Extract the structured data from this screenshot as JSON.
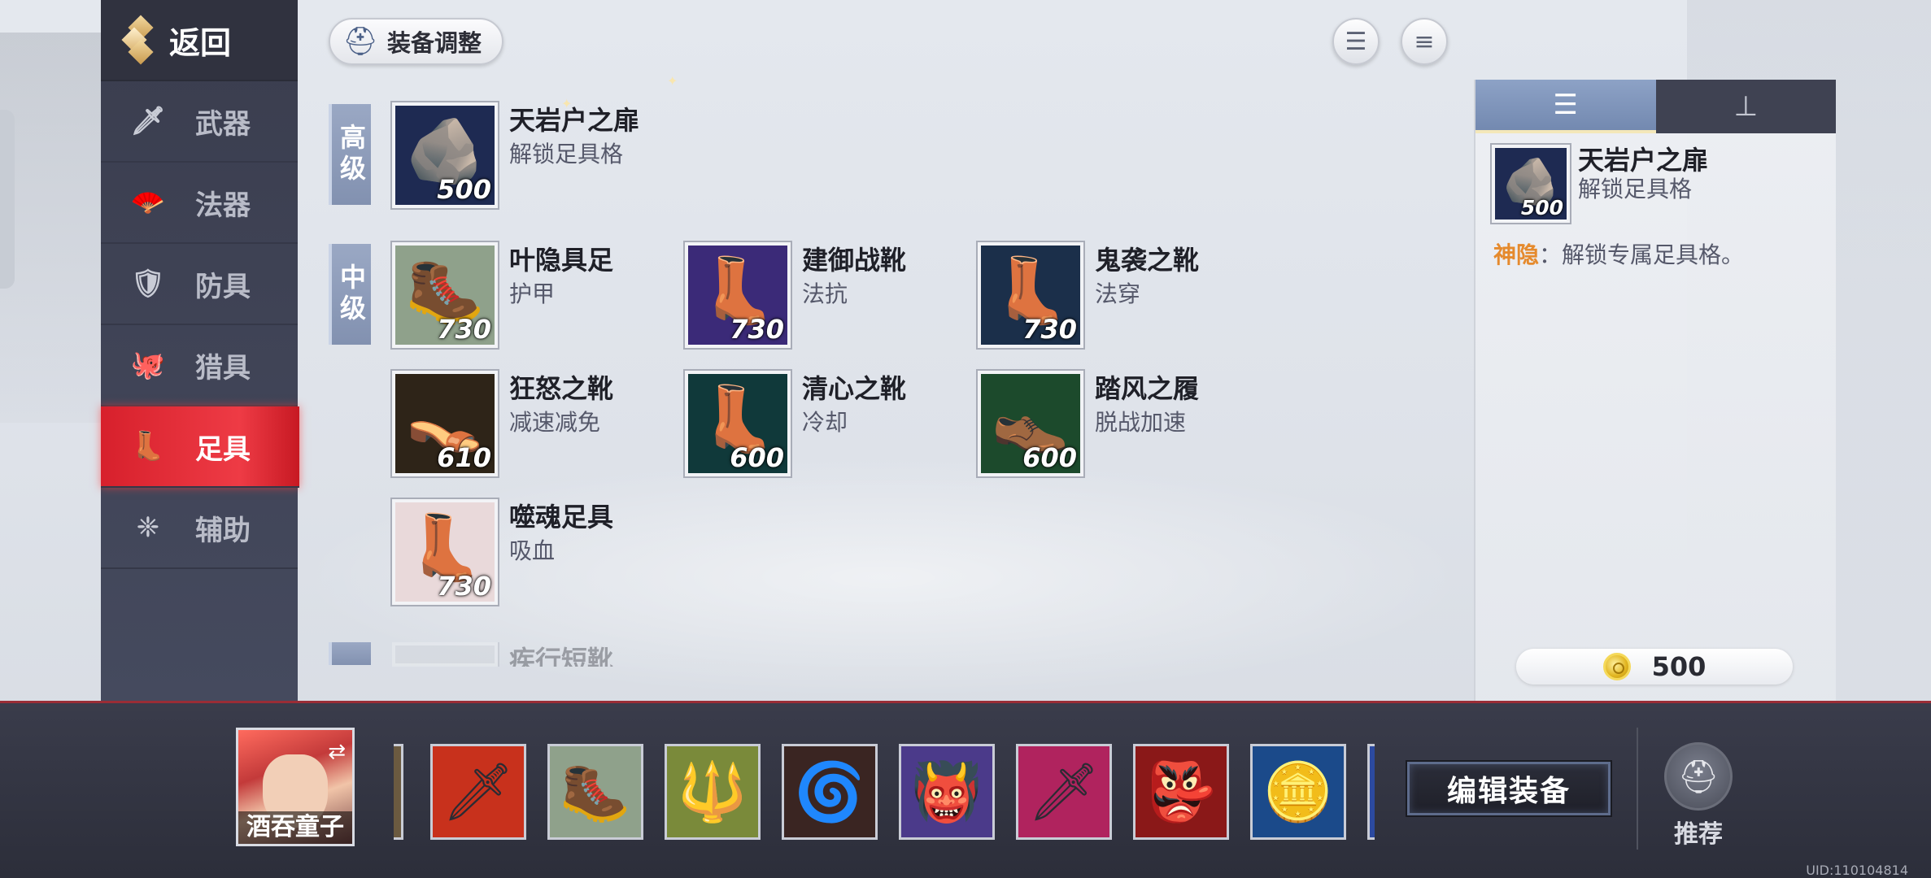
{
  "sidebar": {
    "back_label": "返回",
    "items": [
      {
        "label": "武器",
        "icon": "sword-icon",
        "glyph": "🗡"
      },
      {
        "label": "法器",
        "icon": "fan-icon",
        "glyph": "🪭"
      },
      {
        "label": "防具",
        "icon": "shield-icon",
        "glyph": "🛡"
      },
      {
        "label": "猎具",
        "icon": "octopus-icon",
        "glyph": "🐙"
      },
      {
        "label": "足具",
        "icon": "boot-icon",
        "glyph": "👢",
        "active": true
      },
      {
        "label": "辅助",
        "icon": "support-icon",
        "glyph": "❈"
      }
    ]
  },
  "header": {
    "adjust_label": "装备调整",
    "sort_icon": "sort-icon",
    "menu_icon": "menu-icon"
  },
  "tiers": {
    "high": "高级",
    "mid": "中级"
  },
  "items": [
    {
      "name": "天岩户之扉",
      "desc": "解锁足具格",
      "price": "500",
      "glyph": "🪨",
      "bg": "#1e2a52"
    },
    {
      "name": "叶隐具足",
      "desc": "护甲",
      "price": "730",
      "glyph": "🥾",
      "bg": "#8fa18b"
    },
    {
      "name": "建御战靴",
      "desc": "法抗",
      "price": "730",
      "glyph": "👢",
      "bg": "#3b2a78"
    },
    {
      "name": "鬼袭之靴",
      "desc": "法穿",
      "price": "730",
      "glyph": "👢",
      "bg": "#1b2f4a"
    },
    {
      "name": "狂怒之靴",
      "desc": "减速减免",
      "price": "610",
      "glyph": "👡",
      "bg": "#2e2418"
    },
    {
      "name": "清心之靴",
      "desc": "冷却",
      "price": "600",
      "glyph": "👢",
      "bg": "#10393a"
    },
    {
      "name": "踏风之履",
      "desc": "脱战加速",
      "price": "600",
      "glyph": "👞",
      "bg": "#1c4a2c"
    },
    {
      "name": "噬魂足具",
      "desc": "吸血",
      "price": "730",
      "glyph": "👢",
      "bg": "#e9d9da"
    },
    {
      "name": "疾行短靴",
      "desc": "",
      "price": "",
      "glyph": "",
      "bg": "#cfd2d8"
    }
  ],
  "detail": {
    "tab_list_icon": "list-icon",
    "tab_tree_icon": "tree-icon",
    "name": "天岩户之扉",
    "desc": "解锁足具格",
    "price": "500",
    "effect_name": "神隐",
    "effect_sep": "：",
    "effect_text": "解锁专属足具格。",
    "cost": "500"
  },
  "bottom": {
    "hero_name": "酒吞童子",
    "slots": [
      {
        "icon": "partial-item-icon",
        "glyph": "",
        "bg": "#6b5a40"
      },
      {
        "icon": "flame-sword-icon",
        "glyph": "🗡",
        "bg": "#c8311c"
      },
      {
        "icon": "boots-icon",
        "glyph": "🥾",
        "bg": "#8fa18b"
      },
      {
        "icon": "staff-icon",
        "glyph": "🔱",
        "bg": "#7a8a3a"
      },
      {
        "icon": "blade-ring-icon",
        "glyph": "🌀",
        "bg": "#3a2522"
      },
      {
        "icon": "oni-mask-purple-icon",
        "glyph": "👹",
        "bg": "#4b3a8a"
      },
      {
        "icon": "katana-pink-icon",
        "glyph": "🗡",
        "bg": "#b0235e"
      },
      {
        "icon": "oni-mask-red-icon",
        "glyph": "👺",
        "bg": "#8a1818"
      },
      {
        "icon": "gold-mirror-icon",
        "glyph": "🪙",
        "bg": "#1b4a8a"
      },
      {
        "icon": "partial-item-icon",
        "glyph": "",
        "bg": "#2c4aa0"
      }
    ],
    "edit_label": "编辑装备",
    "recommend_label": "推荐",
    "uid": "UID:110104814"
  }
}
